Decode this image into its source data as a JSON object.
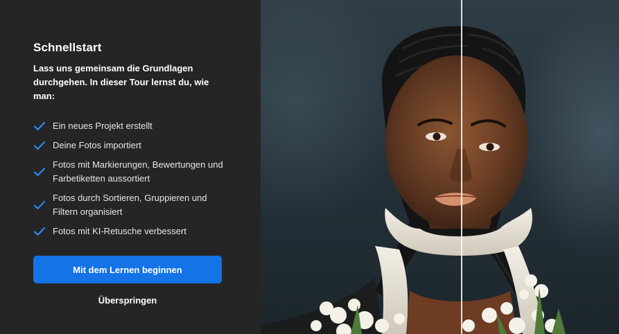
{
  "tour": {
    "title": "Schnellstart",
    "intro": "Lass uns gemeinsam die Grundlagen durchgehen. In dieser Tour lernst du, wie man:",
    "items": [
      {
        "label": "Ein neues Projekt erstellt"
      },
      {
        "label": "Deine Fotos importiert"
      },
      {
        "label": "Fotos mit Markierungen, Bewertungen und Farbetiketten aussortiert"
      },
      {
        "label": "Fotos durch Sortieren, Gruppieren und Filtern organisiert"
      },
      {
        "label": "Fotos mit KI-Retusche verbessert"
      }
    ],
    "start_button": "Mit dem Lernen beginnen",
    "skip_button": "Überspringen"
  },
  "colors": {
    "panel_bg": "#252525",
    "accent": "#1473e6",
    "check": "#2d8cff"
  },
  "icons": {
    "check": "checkmark-icon"
  }
}
